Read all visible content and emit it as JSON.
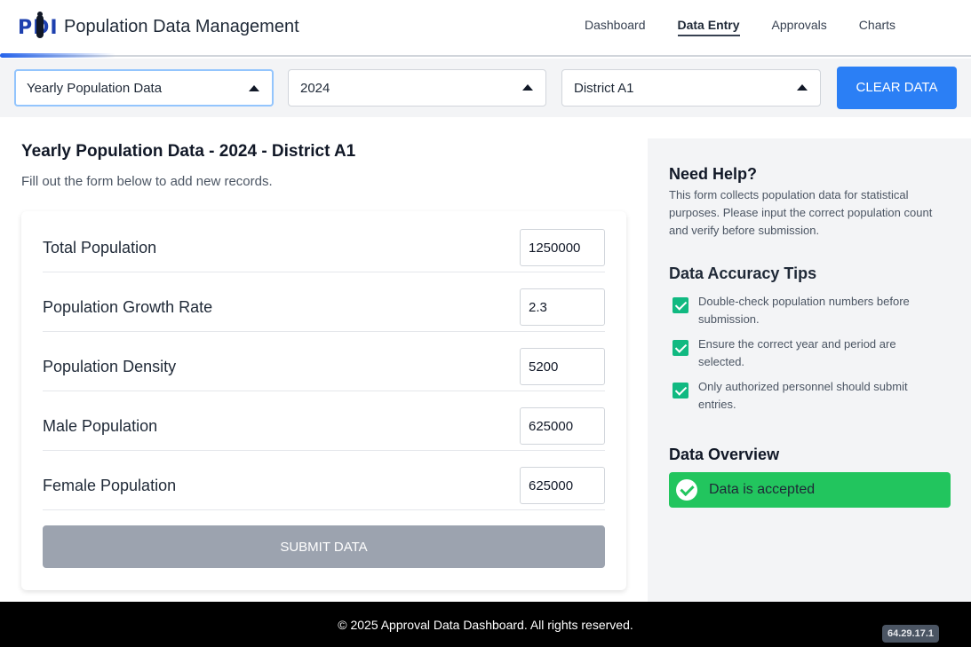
{
  "header": {
    "logo_text": "PDI",
    "app_title": "Population Data Management",
    "nav": [
      {
        "label": "Dashboard",
        "active": false
      },
      {
        "label": "Data Entry",
        "active": true
      },
      {
        "label": "Approvals",
        "active": false
      },
      {
        "label": "Charts",
        "active": false
      }
    ]
  },
  "filters": {
    "data_type": "Yearly Population Data",
    "year": "2024",
    "district": "District A1",
    "clear_label": "CLEAR DATA"
  },
  "main": {
    "title": "Yearly Population Data - 2024 - District A1",
    "subtitle": "Fill out the form below to add new records.",
    "fields": [
      {
        "label": "Total Population",
        "value": "1250000"
      },
      {
        "label": "Population Growth Rate",
        "value": "2.3"
      },
      {
        "label": "Population Density",
        "value": "5200"
      },
      {
        "label": "Male Population",
        "value": "625000"
      },
      {
        "label": "Female Population",
        "value": "625000"
      }
    ],
    "submit_label": "SUBMIT DATA"
  },
  "side": {
    "help_title": "Need Help?",
    "help_text": "This form collects population data for statistical purposes. Please input the correct population count and verify before submission.",
    "tips_title": "Data Accuracy Tips",
    "tips": [
      "Double-check population numbers before submission.",
      "Ensure the correct year and period are selected.",
      "Only authorized personnel should submit entries."
    ],
    "overview_title": "Data Overview",
    "overview_status": "Data is accepted"
  },
  "footer": {
    "copyright": "© 2025 Approval Data Dashboard. All rights reserved.",
    "version": "64.29.17.1"
  },
  "colors": {
    "primary": "#2b7ff5",
    "success": "#22c55e",
    "checkbox": "#10b981",
    "disabled": "#9ca3af"
  }
}
